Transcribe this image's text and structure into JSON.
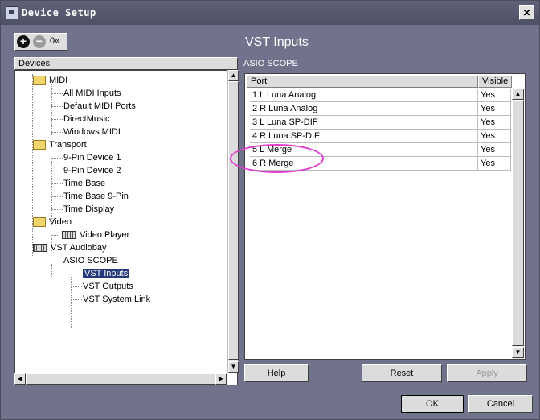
{
  "window": {
    "title": "Device Setup",
    "close_label": "✕"
  },
  "toolbar": {
    "add_symbol": "+",
    "remove_symbol": "−",
    "counter": "0«"
  },
  "panel": {
    "title": "VST Inputs",
    "section": "ASIO SCOPE"
  },
  "devices": {
    "header": "Devices",
    "tree": [
      {
        "label": "MIDI",
        "type": "folder"
      },
      {
        "label": "All MIDI Inputs",
        "type": "leaf"
      },
      {
        "label": "Default MIDI Ports",
        "type": "leaf"
      },
      {
        "label": "DirectMusic",
        "type": "leaf"
      },
      {
        "label": "Windows MIDI",
        "type": "leaf"
      },
      {
        "label": "Transport",
        "type": "folder"
      },
      {
        "label": "9-Pin Device 1",
        "type": "leaf"
      },
      {
        "label": "9-Pin Device 2",
        "type": "leaf"
      },
      {
        "label": "Time Base",
        "type": "leaf"
      },
      {
        "label": "Time Base 9-Pin",
        "type": "leaf"
      },
      {
        "label": "Time Display",
        "type": "leaf"
      },
      {
        "label": "Video",
        "type": "folder"
      },
      {
        "label": "Video Player",
        "type": "device"
      },
      {
        "label": "VST Audiobay",
        "type": "device"
      },
      {
        "label": "ASIO SCOPE",
        "type": "leaf"
      },
      {
        "label": "VST Inputs",
        "type": "leaf",
        "selected": true
      },
      {
        "label": "VST Outputs",
        "type": "leaf"
      },
      {
        "label": "VST System Link",
        "type": "leaf"
      }
    ]
  },
  "ports_table": {
    "columns": [
      "Port",
      "Visible"
    ],
    "rows": [
      {
        "port": "1 L Luna Analog",
        "visible": "Yes"
      },
      {
        "port": "2 R Luna Analog",
        "visible": "Yes"
      },
      {
        "port": "3 L Luna SP-DIF",
        "visible": "Yes"
      },
      {
        "port": "4 R Luna SP-DIF",
        "visible": "Yes"
      },
      {
        "port": "5 L Merge",
        "visible": "Yes"
      },
      {
        "port": "6 R Merge",
        "visible": "Yes"
      }
    ]
  },
  "buttons": {
    "help": "Help",
    "reset": "Reset",
    "apply": "Apply",
    "ok": "OK",
    "cancel": "Cancel"
  },
  "colors": {
    "background": "#71738c",
    "selection": "#243a7a",
    "highlight_ellipse": "#e23cd0"
  }
}
